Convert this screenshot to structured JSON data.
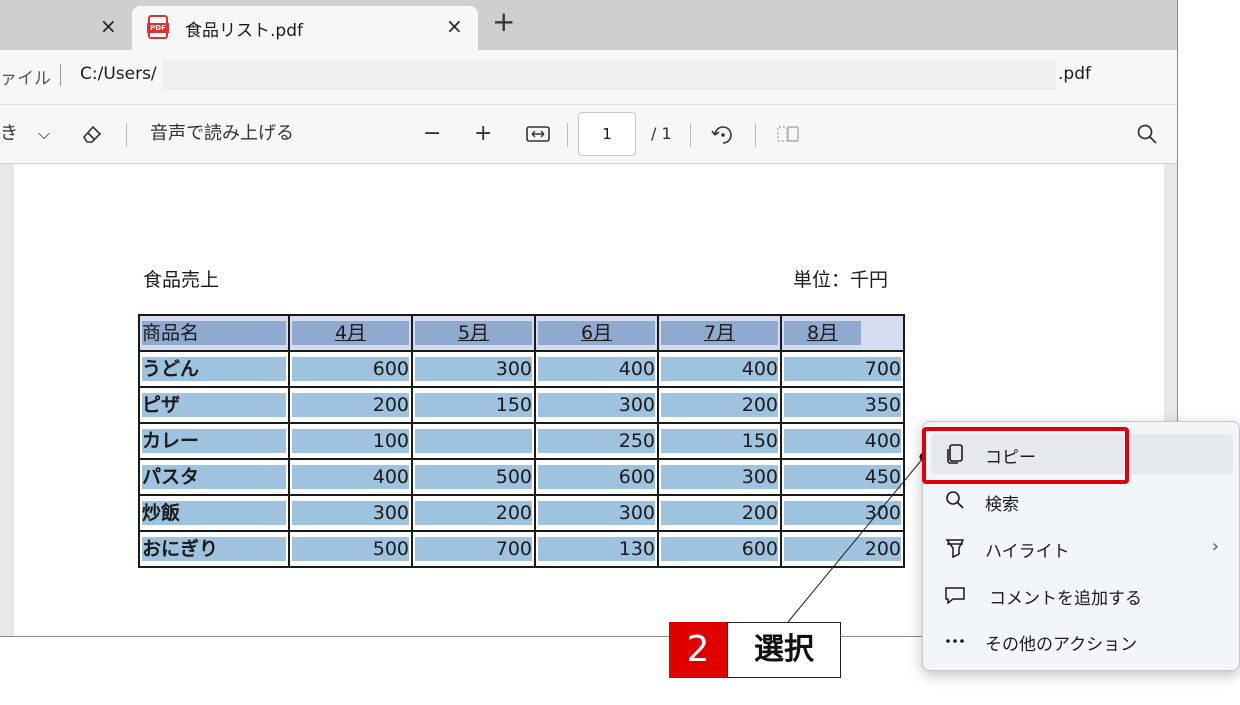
{
  "tabs": {
    "previous_close": "×",
    "active_title": "食品リスト.pdf",
    "active_close": "×",
    "new_tab": "+",
    "pdf_badge": "PDF"
  },
  "address": {
    "scheme_label": "ァイル",
    "url_prefix": "C:/Users/",
    "url_suffix": ".pdf"
  },
  "toolbar": {
    "draw_fragment": "き",
    "chevron": "⌵",
    "read_aloud": "音声で読み上げる",
    "zoom_out": "−",
    "zoom_in": "+",
    "page_number": "1",
    "page_total": "/ 1"
  },
  "document": {
    "title": "食品売上",
    "unit": "単位：千円",
    "headers": [
      "商品名",
      "4月",
      "5月",
      "6月",
      "7月",
      "8月"
    ],
    "rows": [
      {
        "name": "うどん",
        "values": [
          "600",
          "300",
          "400",
          "400",
          "700"
        ]
      },
      {
        "name": "ピザ",
        "values": [
          "200",
          "150",
          "300",
          "200",
          "350"
        ]
      },
      {
        "name": "カレー",
        "values": [
          "100",
          "",
          "250",
          "150",
          "400"
        ]
      },
      {
        "name": "パスタ",
        "values": [
          "400",
          "500",
          "600",
          "300",
          "450"
        ]
      },
      {
        "name": "炒飯",
        "values": [
          "300",
          "200",
          "300",
          "200",
          "300"
        ]
      },
      {
        "name": "おにぎり",
        "values": [
          "500",
          "700",
          "130",
          "600",
          "200"
        ]
      }
    ]
  },
  "context_menu": {
    "items": [
      {
        "label": "コピー",
        "icon": "copy-icon"
      },
      {
        "label": "検索",
        "icon": "search-icon"
      },
      {
        "label": "ハイライト",
        "icon": "highlighter-icon",
        "arrow": "›"
      },
      {
        "label": "コメントを追加する",
        "icon": "comment-icon"
      },
      {
        "label": "その他のアクション",
        "icon": "more-icon"
      }
    ]
  },
  "callout": {
    "step_number": "2",
    "step_label": "選択",
    "highlight_color": "#e0000b"
  },
  "colors": {
    "selection_header": "#8fa9cf",
    "selection_cell": "#9fc3df",
    "badge_red": "#e00000"
  }
}
